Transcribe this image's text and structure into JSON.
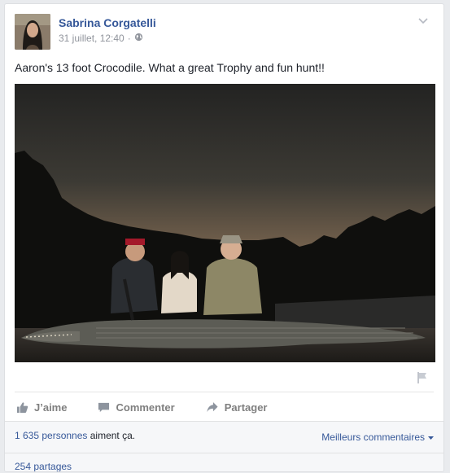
{
  "post": {
    "author": "Sabrina Corgatelli",
    "date": "31 juillet, 12:40",
    "privacy_separator": "·",
    "text": "Aaron's 13 foot Crocodile. What a great Trophy and fun hunt!!"
  },
  "actions": {
    "like": "J’aime",
    "comment": "Commenter",
    "share": "Partager"
  },
  "footer": {
    "likes_count_link": "1 635 personnes",
    "likes_rest": " aiment ça.",
    "best_comments": "Meilleurs commentaires",
    "shares": "254 partages"
  },
  "icons": {
    "privacy": "globe-icon",
    "menu": "chevron-down-icon",
    "report": "flag-icon",
    "like": "thumbs-up-icon",
    "comment": "speech-bubble-icon",
    "share": "share-arrow-icon"
  },
  "colors": {
    "link": "#365899",
    "action_text": "#7f7f7f",
    "background": "#e9ebee"
  }
}
